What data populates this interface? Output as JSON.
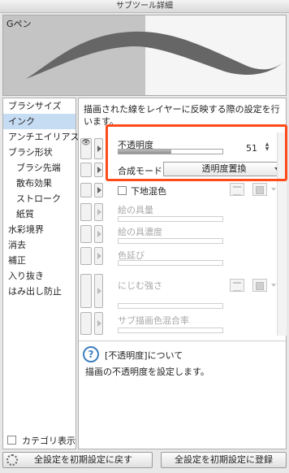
{
  "window": {
    "title": "サブツール詳細"
  },
  "preview": {
    "brush_name": "Gペン"
  },
  "sidebar": {
    "items": [
      {
        "label": "ブラシサイズ",
        "selected": false,
        "sub": false
      },
      {
        "label": "インク",
        "selected": true,
        "sub": false
      },
      {
        "label": "アンチエイリアス",
        "selected": false,
        "sub": false
      },
      {
        "label": "ブラシ形状",
        "selected": false,
        "sub": false
      },
      {
        "label": "ブラシ先端",
        "selected": false,
        "sub": true
      },
      {
        "label": "散布効果",
        "selected": false,
        "sub": true
      },
      {
        "label": "ストローク",
        "selected": false,
        "sub": true
      },
      {
        "label": "紙質",
        "selected": false,
        "sub": true
      },
      {
        "label": "水彩境界",
        "selected": false,
        "sub": false
      },
      {
        "label": "消去",
        "selected": false,
        "sub": false
      },
      {
        "label": "補正",
        "selected": false,
        "sub": false
      },
      {
        "label": "入り抜き",
        "selected": false,
        "sub": false
      },
      {
        "label": "はみ出し防止",
        "selected": false,
        "sub": false
      }
    ],
    "category_display_label": "カテゴリ表示"
  },
  "main": {
    "description": "描画された線をレイヤーに反映する際の設定を行います。",
    "opacity": {
      "label": "不透明度",
      "value": "51",
      "fraction": 0.51
    },
    "blend_mode": {
      "label": "合成モード",
      "value": "透明度置換"
    },
    "underlying_mix": {
      "label": "下地混色"
    },
    "paint_amount": {
      "label": "絵の具量"
    },
    "paint_density": {
      "label": "絵の具濃度"
    },
    "color_stretch": {
      "label": "色延び"
    },
    "blur_strength": {
      "label": "にじむ強さ"
    },
    "sub_color_mix": {
      "label": "サブ描画色混合率"
    }
  },
  "help": {
    "icon": "question-icon",
    "title": "[不透明度]について",
    "text": "描画の不透明度を設定します。"
  },
  "footer": {
    "reset_button": "全設定を初期設定に戻す",
    "register_button": "全設定を初期設定に登録"
  },
  "colors": {
    "accent_highlight": "#ff4a1a",
    "selected_category": "#c6dcf3",
    "help_icon": "#3f7fc0"
  }
}
